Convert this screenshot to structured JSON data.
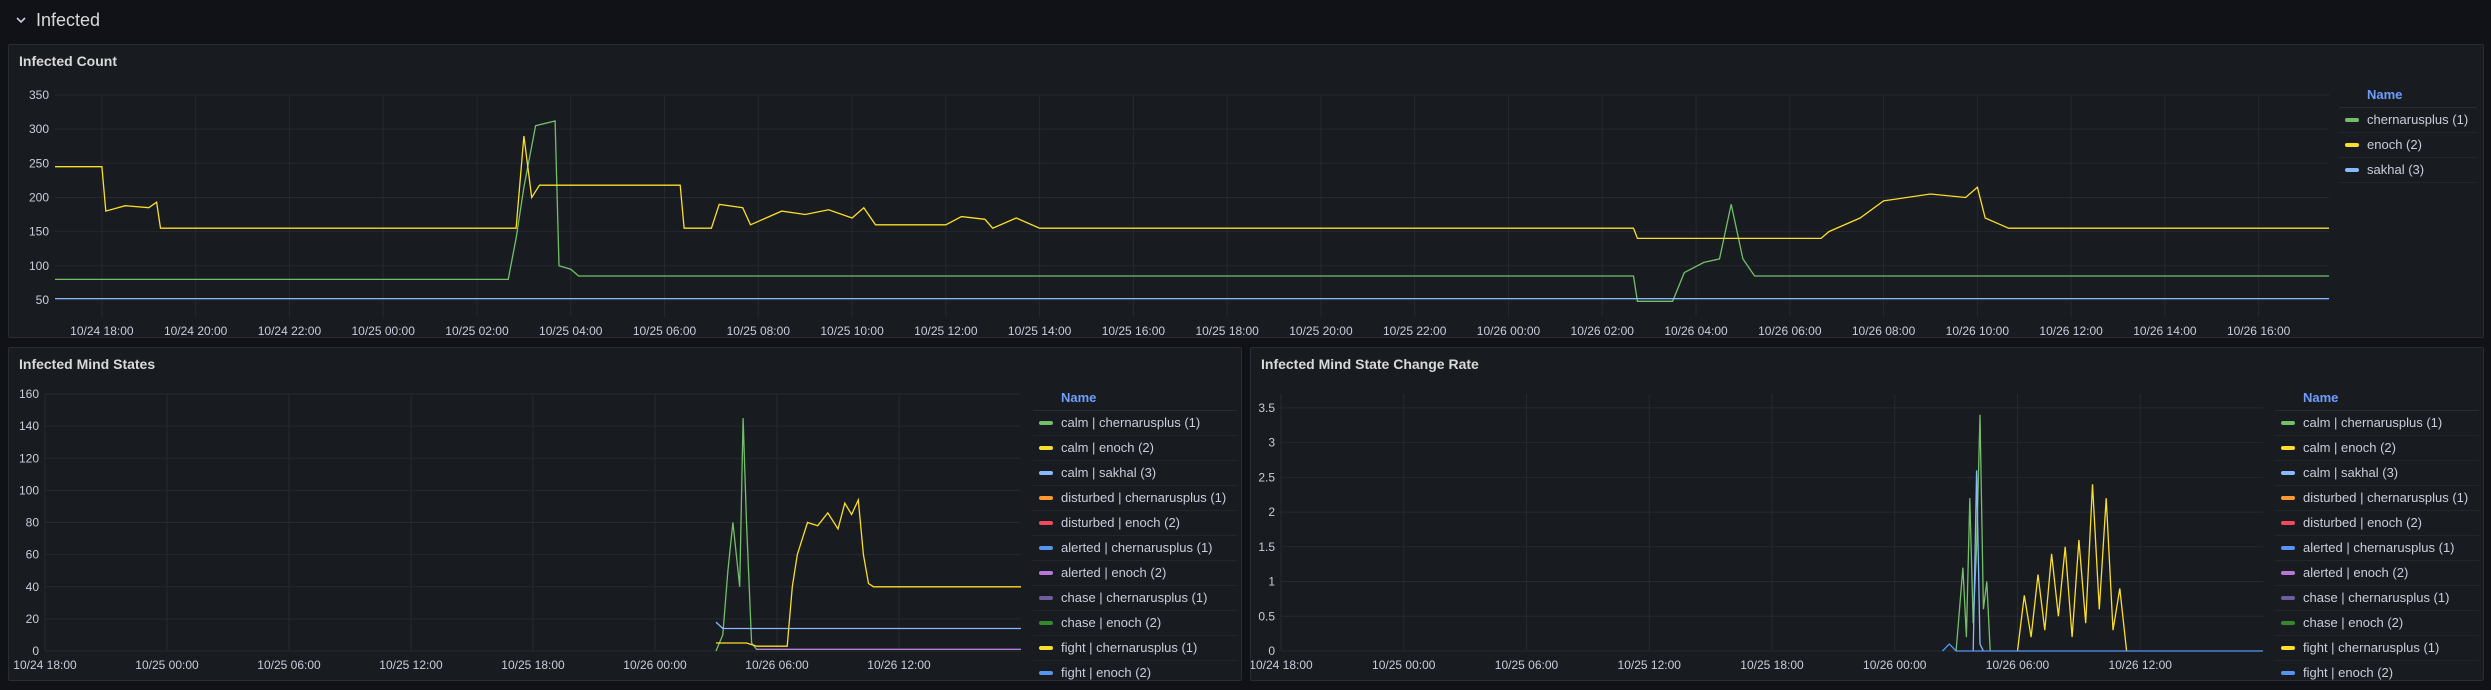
{
  "row": {
    "title": "Infected"
  },
  "colors": {
    "green": "#73bf69",
    "yellow": "#fade2a",
    "lightblue": "#8ab8ff",
    "orange": "#ff9830",
    "red": "#f2495c",
    "blue": "#5794f2",
    "purple": "#b877d9",
    "darkpurple": "#705da0",
    "darkgreen": "#37872d",
    "grid": "#262930",
    "bg": "#181b1f"
  },
  "panels": {
    "count": {
      "title": "Infected Count",
      "legend_header": "Name",
      "legend": [
        {
          "label": "chernarusplus (1)",
          "color": "#73bf69"
        },
        {
          "label": "enoch (2)",
          "color": "#fade2a"
        },
        {
          "label": "sakhal (3)",
          "color": "#8ab8ff"
        }
      ]
    },
    "states": {
      "title": "Infected Mind States",
      "legend_header": "Name",
      "legend": [
        {
          "label": "calm | chernarusplus (1)",
          "color": "#73bf69"
        },
        {
          "label": "calm | enoch (2)",
          "color": "#fade2a"
        },
        {
          "label": "calm | sakhal (3)",
          "color": "#8ab8ff"
        },
        {
          "label": "disturbed | chernarusplus (1)",
          "color": "#ff9830"
        },
        {
          "label": "disturbed | enoch (2)",
          "color": "#f2495c"
        },
        {
          "label": "alerted | chernarusplus (1)",
          "color": "#5794f2"
        },
        {
          "label": "alerted | enoch (2)",
          "color": "#b877d9"
        },
        {
          "label": "chase | chernarusplus (1)",
          "color": "#705da0"
        },
        {
          "label": "chase | enoch (2)",
          "color": "#37872d"
        },
        {
          "label": "fight | chernarusplus (1)",
          "color": "#fade2a"
        },
        {
          "label": "fight | enoch (2)",
          "color": "#5794f2"
        }
      ]
    },
    "rate": {
      "title": "Infected Mind State Change Rate",
      "legend_header": "Name",
      "legend": [
        {
          "label": "calm | chernarusplus (1)",
          "color": "#73bf69"
        },
        {
          "label": "calm | enoch (2)",
          "color": "#fade2a"
        },
        {
          "label": "calm | sakhal (3)",
          "color": "#8ab8ff"
        },
        {
          "label": "disturbed | chernarusplus (1)",
          "color": "#ff9830"
        },
        {
          "label": "disturbed | enoch (2)",
          "color": "#f2495c"
        },
        {
          "label": "alerted | chernarusplus (1)",
          "color": "#5794f2"
        },
        {
          "label": "alerted | enoch (2)",
          "color": "#b877d9"
        },
        {
          "label": "chase | chernarusplus (1)",
          "color": "#705da0"
        },
        {
          "label": "chase | enoch (2)",
          "color": "#37872d"
        },
        {
          "label": "fight | chernarusplus (1)",
          "color": "#fade2a"
        },
        {
          "label": "fight | enoch (2)",
          "color": "#5794f2"
        }
      ]
    }
  },
  "chart_data": [
    {
      "type": "line",
      "title": "Infected Count",
      "ylim": [
        25,
        350
      ],
      "yticks": [
        50,
        100,
        150,
        200,
        250,
        300,
        350
      ],
      "x_range": [
        "10/24 17:00",
        "10/26 17:30"
      ],
      "xticks": [
        "10/24 18:00",
        "10/24 20:00",
        "10/24 22:00",
        "10/25 00:00",
        "10/25 02:00",
        "10/25 04:00",
        "10/25 06:00",
        "10/25 08:00",
        "10/25 10:00",
        "10/25 12:00",
        "10/25 14:00",
        "10/25 16:00",
        "10/25 18:00",
        "10/25 20:00",
        "10/25 22:00",
        "10/26 00:00",
        "10/26 02:00",
        "10/26 04:00",
        "10/26 06:00",
        "10/26 08:00",
        "10/26 10:00",
        "10/26 12:00",
        "10/26 14:00",
        "10/26 16:00"
      ],
      "series": [
        {
          "name": "chernarusplus (1)",
          "color": "#73bf69",
          "points": [
            [
              "10/24 17:00",
              80
            ],
            [
              "10/25 02:40",
              80
            ],
            [
              "10/25 02:50",
              140
            ],
            [
              "10/25 03:00",
              215
            ],
            [
              "10/25 03:15",
              305
            ],
            [
              "10/25 03:40",
              312
            ],
            [
              "10/25 03:45",
              100
            ],
            [
              "10/25 04:00",
              95
            ],
            [
              "10/25 04:10",
              85
            ],
            [
              "10/26 02:40",
              85
            ],
            [
              "10/26 02:45",
              48
            ],
            [
              "10/26 03:30",
              48
            ],
            [
              "10/26 03:45",
              90
            ],
            [
              "10/26 04:10",
              105
            ],
            [
              "10/26 04:30",
              110
            ],
            [
              "10/26 04:45",
              190
            ],
            [
              "10/26 05:00",
              110
            ],
            [
              "10/26 05:15",
              85
            ],
            [
              "10/26 17:30",
              85
            ]
          ]
        },
        {
          "name": "enoch (2)",
          "color": "#fade2a",
          "points": [
            [
              "10/24 17:00",
              245
            ],
            [
              "10/24 18:00",
              245
            ],
            [
              "10/24 18:05",
              180
            ],
            [
              "10/24 18:30",
              188
            ],
            [
              "10/24 19:00",
              185
            ],
            [
              "10/24 19:10",
              193
            ],
            [
              "10/24 19:15",
              155
            ],
            [
              "10/25 02:50",
              155
            ],
            [
              "10/25 03:00",
              290
            ],
            [
              "10/25 03:10",
              200
            ],
            [
              "10/25 03:20",
              218
            ],
            [
              "10/25 06:20",
              218
            ],
            [
              "10/25 06:25",
              155
            ],
            [
              "10/25 07:00",
              155
            ],
            [
              "10/25 07:10",
              190
            ],
            [
              "10/25 07:40",
              185
            ],
            [
              "10/25 07:50",
              160
            ],
            [
              "10/25 08:30",
              180
            ],
            [
              "10/25 09:00",
              175
            ],
            [
              "10/25 09:30",
              182
            ],
            [
              "10/25 10:00",
              170
            ],
            [
              "10/25 10:15",
              185
            ],
            [
              "10/25 10:30",
              160
            ],
            [
              "10/25 12:00",
              160
            ],
            [
              "10/25 12:20",
              172
            ],
            [
              "10/25 12:50",
              168
            ],
            [
              "10/25 13:00",
              155
            ],
            [
              "10/25 13:30",
              170
            ],
            [
              "10/25 14:00",
              155
            ],
            [
              "10/26 02:40",
              155
            ],
            [
              "10/26 02:45",
              140
            ],
            [
              "10/26 06:40",
              140
            ],
            [
              "10/26 06:50",
              150
            ],
            [
              "10/26 07:30",
              170
            ],
            [
              "10/26 08:00",
              195
            ],
            [
              "10/26 09:00",
              205
            ],
            [
              "10/26 09:45",
              200
            ],
            [
              "10/26 10:00",
              215
            ],
            [
              "10/26 10:10",
              170
            ],
            [
              "10/26 10:30",
              160
            ],
            [
              "10/26 10:40",
              155
            ],
            [
              "10/26 17:30",
              155
            ]
          ]
        },
        {
          "name": "sakhal (3)",
          "color": "#8ab8ff",
          "points": [
            [
              "10/24 17:00",
              52
            ],
            [
              "10/26 17:30",
              52
            ]
          ]
        }
      ]
    },
    {
      "type": "line",
      "title": "Infected Mind States",
      "ylim": [
        0,
        160
      ],
      "yticks": [
        0,
        20,
        40,
        60,
        80,
        100,
        120,
        140,
        160
      ],
      "x_range": [
        "10/24 18:00",
        "10/26 18:00"
      ],
      "xticks": [
        "10/24 18:00",
        "10/25 00:00",
        "10/25 06:00",
        "10/25 12:00",
        "10/25 18:00",
        "10/26 00:00",
        "10/26 06:00",
        "10/26 12:00"
      ],
      "series": [
        {
          "name": "calm | chernarusplus (1)",
          "color": "#73bf69",
          "points": [
            [
              "10/26 03:00",
              0
            ],
            [
              "10/26 03:20",
              10
            ],
            [
              "10/26 03:35",
              50
            ],
            [
              "10/26 03:50",
              80
            ],
            [
              "10/26 04:00",
              60
            ],
            [
              "10/26 04:10",
              40
            ],
            [
              "10/26 04:20",
              145
            ],
            [
              "10/26 04:30",
              80
            ],
            [
              "10/26 04:45",
              5
            ],
            [
              "10/26 05:00",
              1
            ],
            [
              "10/26 18:00",
              1
            ]
          ]
        },
        {
          "name": "calm | enoch (2)",
          "color": "#fade2a",
          "points": [
            [
              "10/26 03:00",
              5
            ],
            [
              "10/26 04:30",
              5
            ],
            [
              "10/26 05:00",
              3
            ],
            [
              "10/26 06:30",
              3
            ],
            [
              "10/26 06:45",
              40
            ],
            [
              "10/26 07:00",
              60
            ],
            [
              "10/26 07:30",
              80
            ],
            [
              "10/26 08:00",
              78
            ],
            [
              "10/26 08:30",
              86
            ],
            [
              "10/26 09:00",
              76
            ],
            [
              "10/26 09:20",
              92
            ],
            [
              "10/26 09:40",
              85
            ],
            [
              "10/26 10:00",
              94
            ],
            [
              "10/26 10:15",
              60
            ],
            [
              "10/26 10:30",
              42
            ],
            [
              "10/26 10:45",
              40
            ],
            [
              "10/26 18:00",
              40
            ]
          ]
        },
        {
          "name": "calm | sakhal (3)",
          "color": "#8ab8ff",
          "points": [
            [
              "10/26 03:00",
              18
            ],
            [
              "10/26 03:20",
              14
            ],
            [
              "10/26 18:00",
              14
            ]
          ]
        },
        {
          "name": "alerted | enoch (2)",
          "color": "#b877d9",
          "points": [
            [
              "10/26 05:00",
              1
            ],
            [
              "10/26 18:00",
              1
            ]
          ]
        }
      ]
    },
    {
      "type": "line",
      "title": "Infected Mind State Change Rate",
      "ylim": [
        0,
        3.7
      ],
      "yticks": [
        0,
        0.5,
        1,
        1.5,
        2,
        2.5,
        3,
        3.5
      ],
      "x_range": [
        "10/24 18:00",
        "10/26 18:00"
      ],
      "xticks": [
        "10/24 18:00",
        "10/25 00:00",
        "10/25 06:00",
        "10/25 12:00",
        "10/25 18:00",
        "10/26 00:00",
        "10/26 06:00",
        "10/26 12:00"
      ],
      "series": [
        {
          "name": "calm | chernarusplus (1)",
          "color": "#73bf69",
          "points": [
            [
              "10/26 03:00",
              0
            ],
            [
              "10/26 03:20",
              1.2
            ],
            [
              "10/26 03:30",
              0.2
            ],
            [
              "10/26 03:40",
              2.2
            ],
            [
              "10/26 03:50",
              0.4
            ],
            [
              "10/26 04:00",
              1.5
            ],
            [
              "10/26 04:10",
              3.4
            ],
            [
              "10/26 04:20",
              0.6
            ],
            [
              "10/26 04:30",
              1.0
            ],
            [
              "10/26 04:40",
              0
            ]
          ]
        },
        {
          "name": "calm | enoch (2)",
          "color": "#fade2a",
          "points": [
            [
              "10/26 06:00",
              0
            ],
            [
              "10/26 06:20",
              0.8
            ],
            [
              "10/26 06:40",
              0.2
            ],
            [
              "10/26 07:00",
              1.1
            ],
            [
              "10/26 07:20",
              0.3
            ],
            [
              "10/26 07:40",
              1.4
            ],
            [
              "10/26 08:00",
              0.5
            ],
            [
              "10/26 08:20",
              1.5
            ],
            [
              "10/26 08:40",
              0.2
            ],
            [
              "10/26 09:00",
              1.6
            ],
            [
              "10/26 09:20",
              0.4
            ],
            [
              "10/26 09:40",
              2.4
            ],
            [
              "10/26 10:00",
              0.6
            ],
            [
              "10/26 10:20",
              2.2
            ],
            [
              "10/26 10:40",
              0.3
            ],
            [
              "10/26 11:00",
              0.9
            ],
            [
              "10/26 11:20",
              0
            ]
          ]
        },
        {
          "name": "calm | sakhal (3)",
          "color": "#8ab8ff",
          "points": [
            [
              "10/26 03:50",
              0
            ],
            [
              "10/26 04:00",
              2.6
            ],
            [
              "10/26 04:10",
              0.1
            ],
            [
              "10/26 04:20",
              0
            ]
          ]
        },
        {
          "name": "fight | enoch (2)",
          "color": "#5794f2",
          "points": [
            [
              "10/26 02:20",
              0
            ],
            [
              "10/26 02:40",
              0.1
            ],
            [
              "10/26 03:00",
              0
            ],
            [
              "10/26 18:00",
              0
            ]
          ]
        }
      ]
    }
  ]
}
